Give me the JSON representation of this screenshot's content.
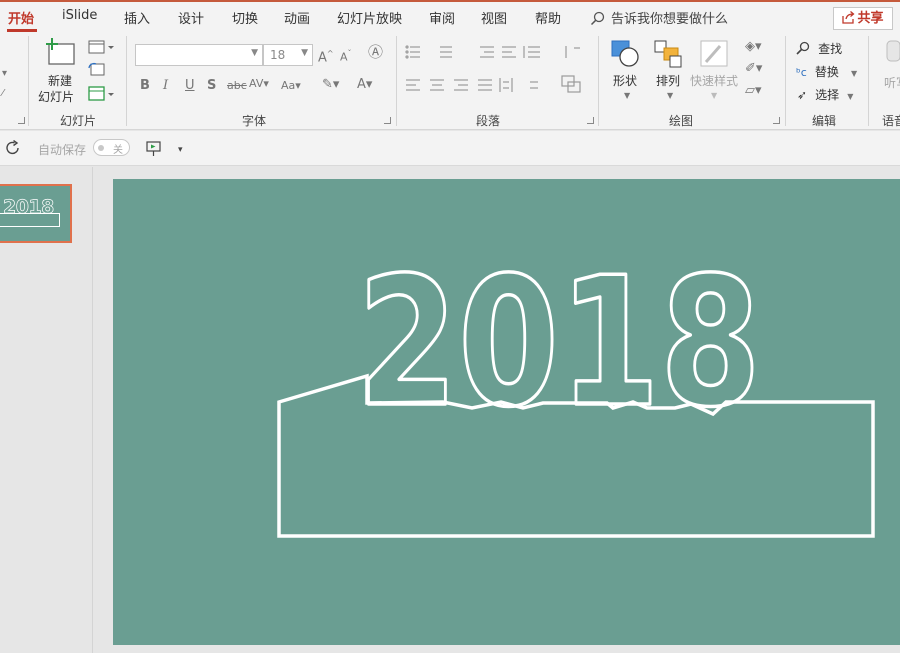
{
  "tabs": [
    "开始",
    "iSlide",
    "插入",
    "设计",
    "切换",
    "动画",
    "幻灯片放映",
    "审阅",
    "视图",
    "帮助"
  ],
  "active_tab": "开始",
  "tell_me": "告诉我你想要做什么",
  "share": "共享",
  "ribbon": {
    "slides": {
      "new_slide_line1": "新建",
      "new_slide_line2": "幻灯片",
      "label": "幻灯片"
    },
    "font": {
      "font_name": "",
      "font_size": "18",
      "label": "字体"
    },
    "paragraph": {
      "label": "段落"
    },
    "drawing": {
      "shapes": "形状",
      "arrange": "排列",
      "quick_styles": "快速样式",
      "label": "绘图"
    },
    "editing": {
      "find": "查找",
      "replace": "替换",
      "select": "选择",
      "label": "编辑"
    },
    "voice": {
      "dictate": "听写",
      "label": "语音"
    }
  },
  "qat": {
    "autosave_label": "自动保存",
    "autosave_state": "关"
  },
  "slide": {
    "number": 1,
    "year_text": "2018",
    "background": "#6a9e92",
    "outline_color": "#ffffff"
  },
  "colors": {
    "accent": "#c0392b",
    "thumb_border": "#e0714c"
  }
}
